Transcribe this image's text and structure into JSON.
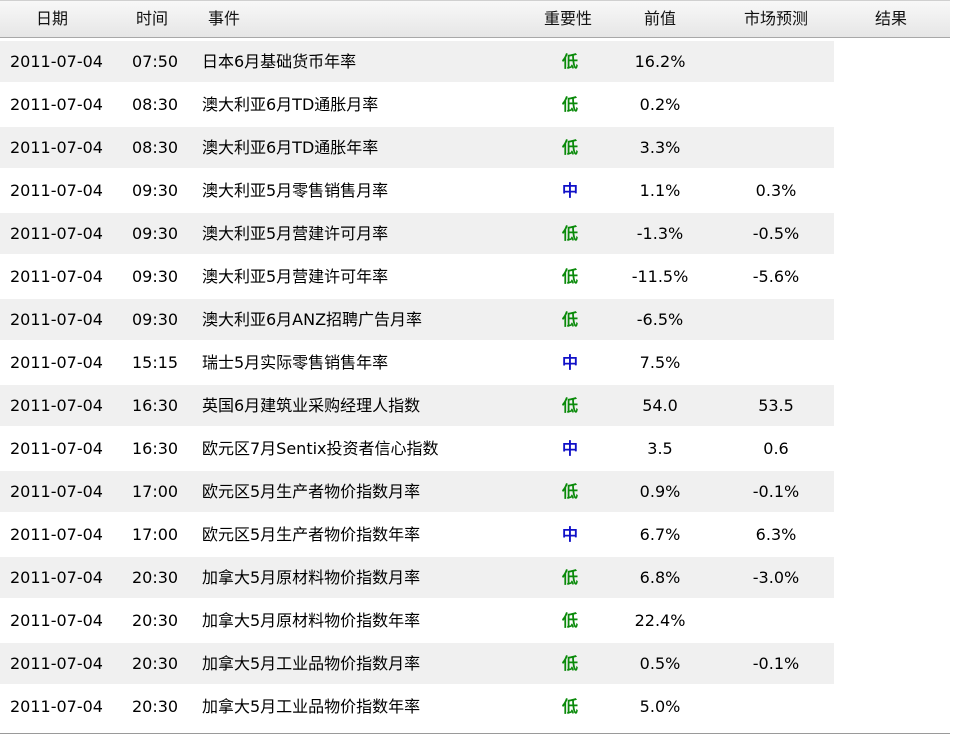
{
  "headers": {
    "date": "日期",
    "time": "时间",
    "event": "事件",
    "importance": "重要性",
    "previous": "前值",
    "forecast": "市场预测",
    "result": "结果"
  },
  "colors": {
    "low": "#0a8a0a",
    "mid": "#1010c8"
  },
  "rows": [
    {
      "date": "2011-07-04",
      "time": "07:50",
      "event": "日本6月基础货币年率",
      "importance": "低",
      "level": "low",
      "previous": "16.2%",
      "forecast": "",
      "result": ""
    },
    {
      "date": "2011-07-04",
      "time": "08:30",
      "event": "澳大利亚6月TD通胀月率",
      "importance": "低",
      "level": "low",
      "previous": "0.2%",
      "forecast": "",
      "result": ""
    },
    {
      "date": "2011-07-04",
      "time": "08:30",
      "event": "澳大利亚6月TD通胀年率",
      "importance": "低",
      "level": "low",
      "previous": "3.3%",
      "forecast": "",
      "result": ""
    },
    {
      "date": "2011-07-04",
      "time": "09:30",
      "event": "澳大利亚5月零售销售月率",
      "importance": "中",
      "level": "mid",
      "previous": "1.1%",
      "forecast": "0.3%",
      "result": ""
    },
    {
      "date": "2011-07-04",
      "time": "09:30",
      "event": "澳大利亚5月营建许可月率",
      "importance": "低",
      "level": "low",
      "previous": "-1.3%",
      "forecast": "-0.5%",
      "result": ""
    },
    {
      "date": "2011-07-04",
      "time": "09:30",
      "event": "澳大利亚5月营建许可年率",
      "importance": "低",
      "level": "low",
      "previous": "-11.5%",
      "forecast": "-5.6%",
      "result": ""
    },
    {
      "date": "2011-07-04",
      "time": "09:30",
      "event": "澳大利亚6月ANZ招聘广告月率",
      "importance": "低",
      "level": "low",
      "previous": "-6.5%",
      "forecast": "",
      "result": ""
    },
    {
      "date": "2011-07-04",
      "time": "15:15",
      "event": "瑞士5月实际零售销售年率",
      "importance": "中",
      "level": "mid",
      "previous": "7.5%",
      "forecast": "",
      "result": ""
    },
    {
      "date": "2011-07-04",
      "time": "16:30",
      "event": "英国6月建筑业采购经理人指数",
      "importance": "低",
      "level": "low",
      "previous": "54.0",
      "forecast": "53.5",
      "result": ""
    },
    {
      "date": "2011-07-04",
      "time": "16:30",
      "event": "欧元区7月Sentix投资者信心指数",
      "importance": "中",
      "level": "mid",
      "previous": "3.5",
      "forecast": "0.6",
      "result": ""
    },
    {
      "date": "2011-07-04",
      "time": "17:00",
      "event": "欧元区5月生产者物价指数月率",
      "importance": "低",
      "level": "low",
      "previous": "0.9%",
      "forecast": "-0.1%",
      "result": ""
    },
    {
      "date": "2011-07-04",
      "time": "17:00",
      "event": "欧元区5月生产者物价指数年率",
      "importance": "中",
      "level": "mid",
      "previous": "6.7%",
      "forecast": "6.3%",
      "result": ""
    },
    {
      "date": "2011-07-04",
      "time": "20:30",
      "event": "加拿大5月原材料物价指数月率",
      "importance": "低",
      "level": "low",
      "previous": "6.8%",
      "forecast": "-3.0%",
      "result": ""
    },
    {
      "date": "2011-07-04",
      "time": "20:30",
      "event": "加拿大5月原材料物价指数年率",
      "importance": "低",
      "level": "low",
      "previous": "22.4%",
      "forecast": "",
      "result": ""
    },
    {
      "date": "2011-07-04",
      "time": "20:30",
      "event": "加拿大5月工业品物价指数月率",
      "importance": "低",
      "level": "low",
      "previous": "0.5%",
      "forecast": "-0.1%",
      "result": ""
    },
    {
      "date": "2011-07-04",
      "time": "20:30",
      "event": "加拿大5月工业品物价指数年率",
      "importance": "低",
      "level": "low",
      "previous": "5.0%",
      "forecast": "",
      "result": ""
    }
  ]
}
